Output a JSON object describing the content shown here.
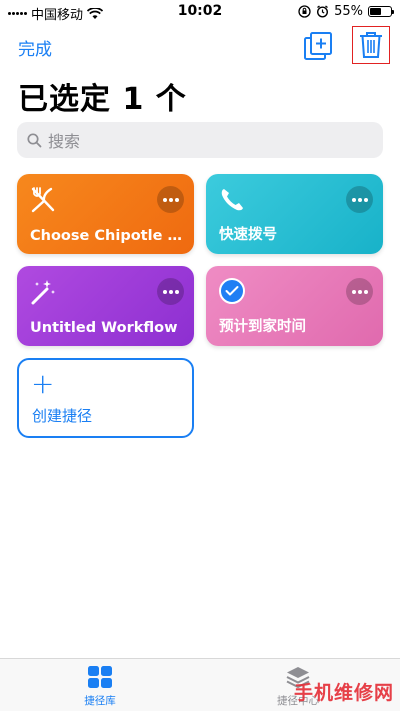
{
  "status_bar": {
    "carrier": "中国移动",
    "time": "10:02",
    "battery": "55%",
    "battery_level": 0.55
  },
  "nav": {
    "done": "完成"
  },
  "title": "已选定 1 个",
  "search": {
    "placeholder": "搜索"
  },
  "shortcuts": [
    {
      "label": "Choose Chipotle O...",
      "icon": "fork-knife-icon",
      "color": "#f47a18"
    },
    {
      "label": "快速拨号",
      "icon": "phone-icon",
      "color": "#26bdd2"
    },
    {
      "label": "Untitled Workflow",
      "icon": "magic-wand-icon",
      "color": "#a03ed9"
    },
    {
      "label": "预计到家时间",
      "icon": "checkmark-icon",
      "color": "#e77bb9",
      "selected": true
    }
  ],
  "create": {
    "label": "创建捷径"
  },
  "tabs": [
    {
      "label": "捷径库",
      "icon": "grid-icon",
      "active": true
    },
    {
      "label": "捷径中心",
      "icon": "layers-icon",
      "active": false
    }
  ],
  "watermark": "手机维修网"
}
